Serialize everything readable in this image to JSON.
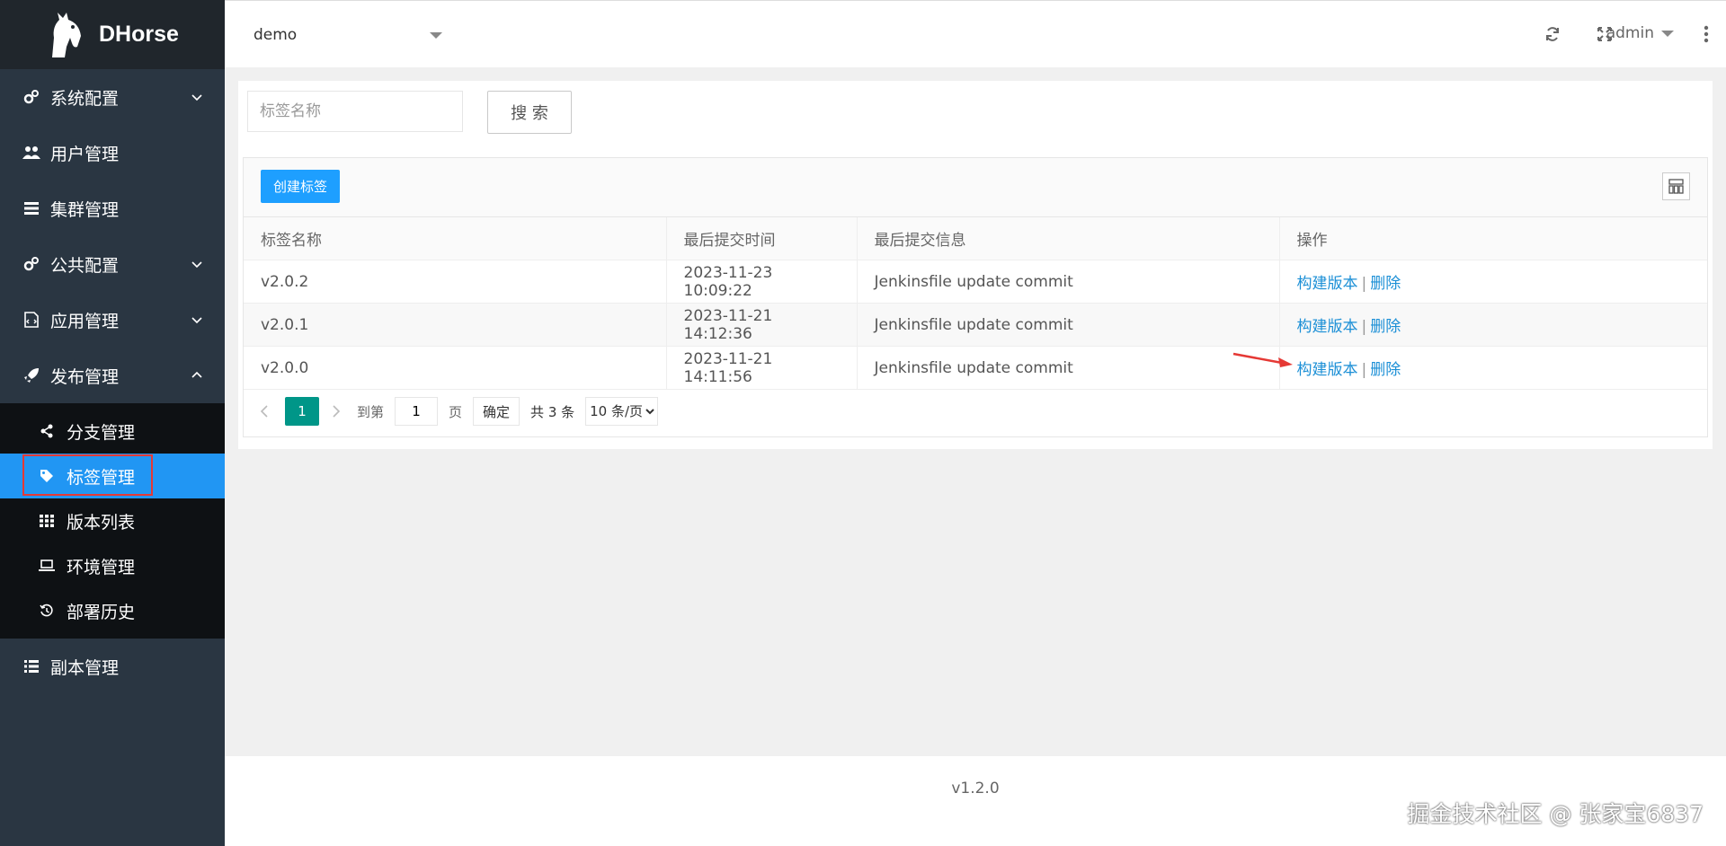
{
  "brand": {
    "name": "DHorse"
  },
  "sidebar": {
    "items": [
      {
        "label": "系统配置",
        "icon": "gears-icon",
        "expandable": true
      },
      {
        "label": "用户管理",
        "icon": "users-icon",
        "expandable": false
      },
      {
        "label": "集群管理",
        "icon": "server-icon",
        "expandable": false
      },
      {
        "label": "公共配置",
        "icon": "gears-icon",
        "expandable": true
      },
      {
        "label": "应用管理",
        "icon": "file-code-icon",
        "expandable": true
      },
      {
        "label": "发布管理",
        "icon": "rocket-icon",
        "expandable": true,
        "expanded": true
      }
    ],
    "submenu": [
      {
        "label": "分支管理",
        "icon": "share-icon"
      },
      {
        "label": "标签管理",
        "icon": "tag-icon",
        "active": true
      },
      {
        "label": "版本列表",
        "icon": "grid-icon"
      },
      {
        "label": "环境管理",
        "icon": "laptop-icon"
      },
      {
        "label": "部署历史",
        "icon": "history-icon"
      }
    ],
    "bottom_items": [
      {
        "label": "副本管理",
        "icon": "list-icon"
      }
    ]
  },
  "header": {
    "app_selected": "demo",
    "user": "admin"
  },
  "search": {
    "placeholder": "标签名称",
    "button": "搜 索"
  },
  "table": {
    "create_button": "创建标签",
    "columns": [
      "标签名称",
      "最后提交时间",
      "最后提交信息",
      "操作"
    ],
    "rows": [
      {
        "name": "v2.0.2",
        "time": "2023-11-23 10:09:22",
        "message": "Jenkinsfile update commit"
      },
      {
        "name": "v2.0.1",
        "time": "2023-11-21 14:12:36",
        "message": "Jenkinsfile update commit"
      },
      {
        "name": "v2.0.0",
        "time": "2023-11-21 14:11:56",
        "message": "Jenkinsfile update commit"
      }
    ],
    "actions": {
      "build": "构建版本",
      "separator": "|",
      "delete": "删除"
    }
  },
  "pagination": {
    "current_page": "1",
    "goto_label": "到第",
    "goto_value": "1",
    "page_unit": "页",
    "confirm": "确定",
    "total": "共 3 条",
    "page_size": "10 条/页"
  },
  "footer": {
    "version": "v1.2.0",
    "credit": "掘金技术社区 @ 张家宝6837"
  },
  "colors": {
    "sidebar_bg": "#2a3642",
    "active_item": "#2196f3",
    "primary_button": "#1e9fff",
    "page_button": "#009688",
    "link": "#1b8fd6"
  }
}
